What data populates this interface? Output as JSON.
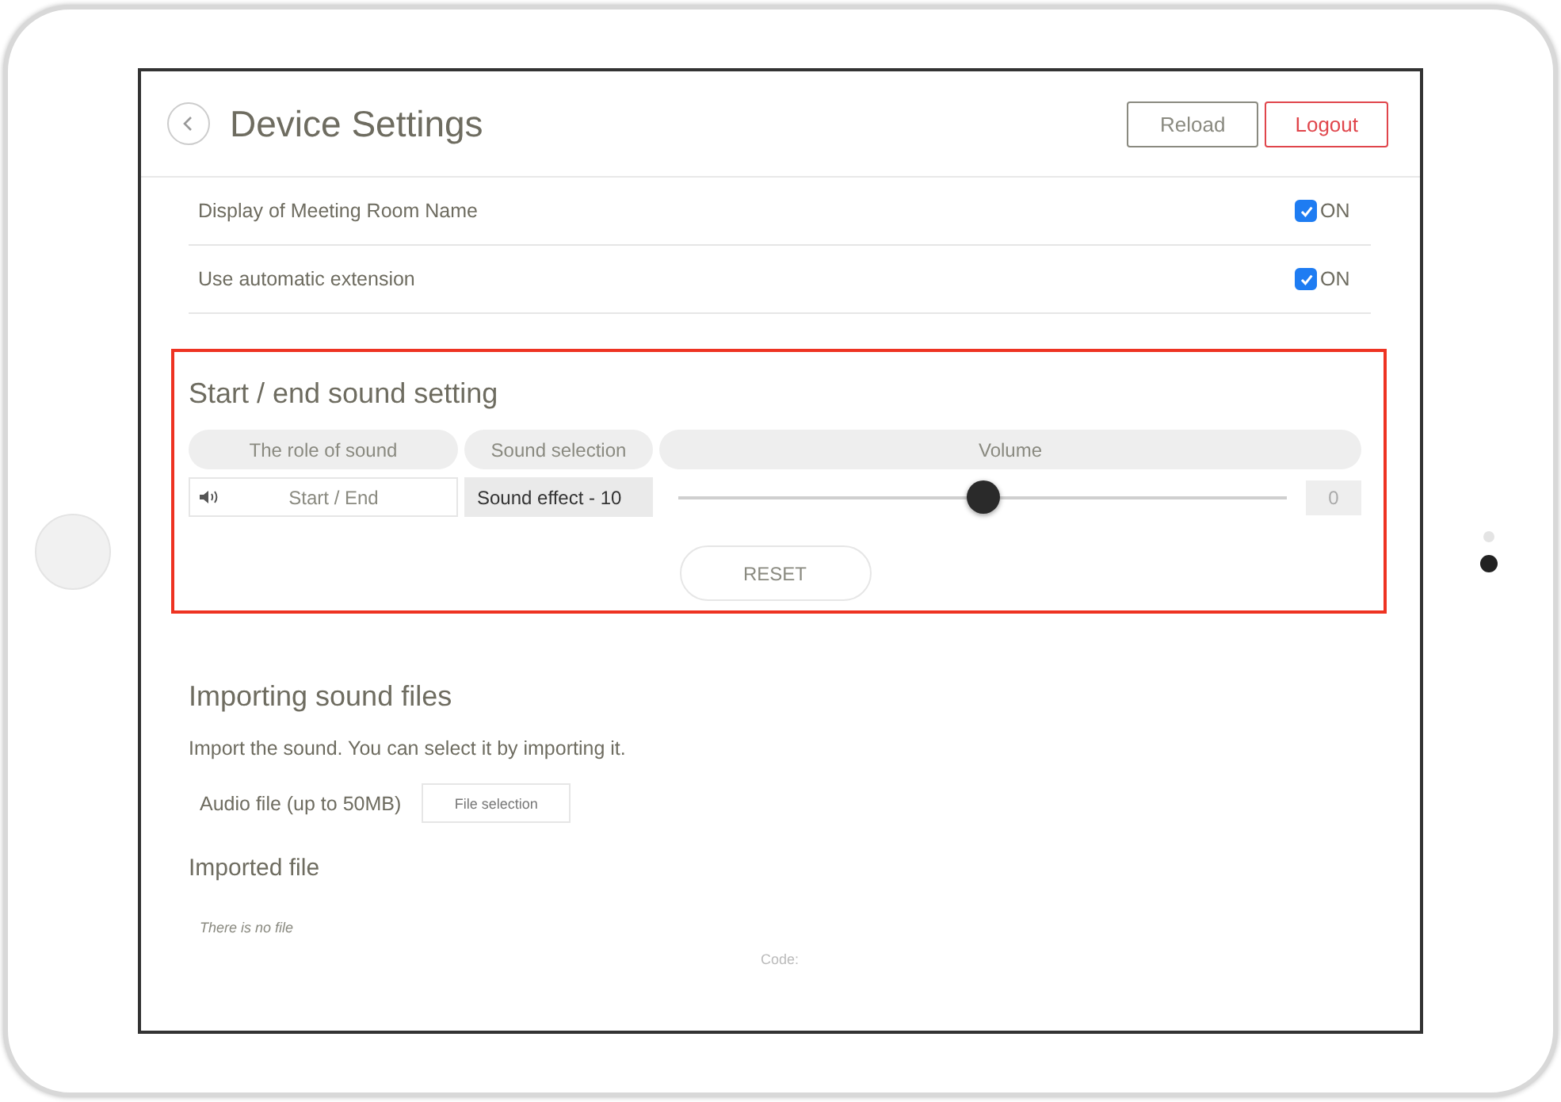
{
  "header": {
    "title": "Device Settings",
    "buttons": [
      {
        "label": "Reload",
        "kind": "plain"
      },
      {
        "label": "Logout",
        "kind": "danger"
      }
    ]
  },
  "settings": [
    {
      "label": "Display of Meeting Room Name",
      "checked": true,
      "value": "ON"
    },
    {
      "label": "Use automatic extension",
      "checked": true,
      "value": "ON"
    }
  ],
  "sound_setting": {
    "title": "Start / end sound setting",
    "highlighted": true,
    "columns": [
      "The role of sound",
      "Sound selection",
      "Volume"
    ],
    "row": {
      "role": "Start / End",
      "sound": "Sound effect - 10",
      "level": 0.5,
      "reading": "0"
    },
    "reset": "RESET"
  },
  "import": {
    "title": "Importing sound files",
    "description": "Import the sound. You can select it by importing it.",
    "file_label": "Audio file (up to 50MB)",
    "file_button": "File selection",
    "imported_title": "Imported file",
    "empty_text": "There is no file",
    "code_label": "Code:"
  }
}
